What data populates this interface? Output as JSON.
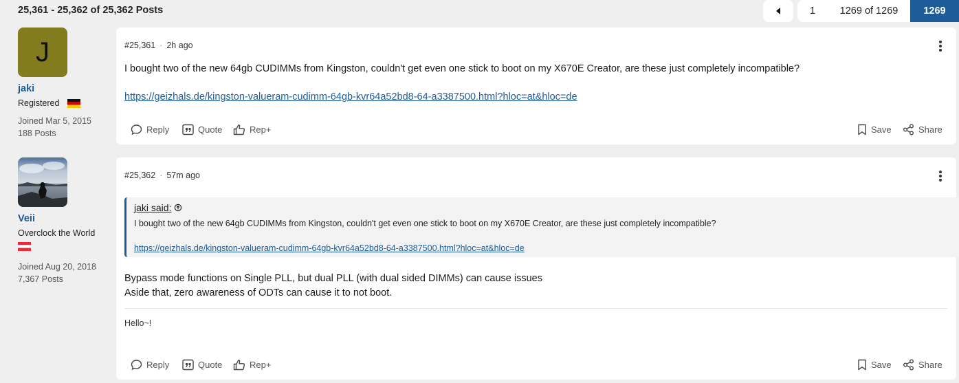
{
  "header": {
    "posts_count": "25,361 - 25,362 of 25,362 Posts",
    "pagination": {
      "prev_icon": "caret-left-icon",
      "first": "1",
      "page_of": "1269 of 1269",
      "current": "1269"
    }
  },
  "actions": {
    "reply": "Reply",
    "quote": "Quote",
    "rep": "Rep+",
    "save": "Save",
    "share": "Share"
  },
  "posts": [
    {
      "author": {
        "avatar_letter": "J",
        "avatar_color": "#837c1f",
        "name": "jaki",
        "title": "Registered",
        "flag": "Germany",
        "joined": "Joined Mar 5, 2015",
        "posts": "188 Posts"
      },
      "number": "#25,361",
      "time": "2h ago",
      "text": "I bought two of the new 64gb CUDIMMs from Kingston, couldn't get even one stick to boot on my X670E Creator, are these just completely incompatible?",
      "link": "https://geizhals.de/kingston-valueram-cudimm-64gb-kvr64a52bd8-64-a3387500.html?hloc=at&hloc=de"
    },
    {
      "author": {
        "name": "Veii",
        "title": "Overclock the World",
        "flag": "Austria",
        "joined": "Joined Aug 20, 2018",
        "posts": "7,367 Posts"
      },
      "number": "#25,362",
      "time": "57m ago",
      "quote": {
        "author": "jaki said:",
        "text": "I bought two of the new 64gb CUDIMMs from Kingston, couldn't get even one stick to boot on my X670E Creator, are these just completely incompatible?",
        "link": "https://geizhals.de/kingston-valueram-cudimm-64gb-kvr64a52bd8-64-a3387500.html?hloc=at&hloc=de"
      },
      "text_line1": "Bypass mode functions on Single PLL, but dual PLL (with dual sided DIMMs) can cause issues",
      "text_line2": "Aside that, zero awareness of ODTs can cause it to not boot.",
      "signature": "Hello~!"
    }
  ],
  "colors": {
    "accent": "#1e5c99",
    "page_background": "#efefef",
    "card_background": "#ffffff"
  }
}
